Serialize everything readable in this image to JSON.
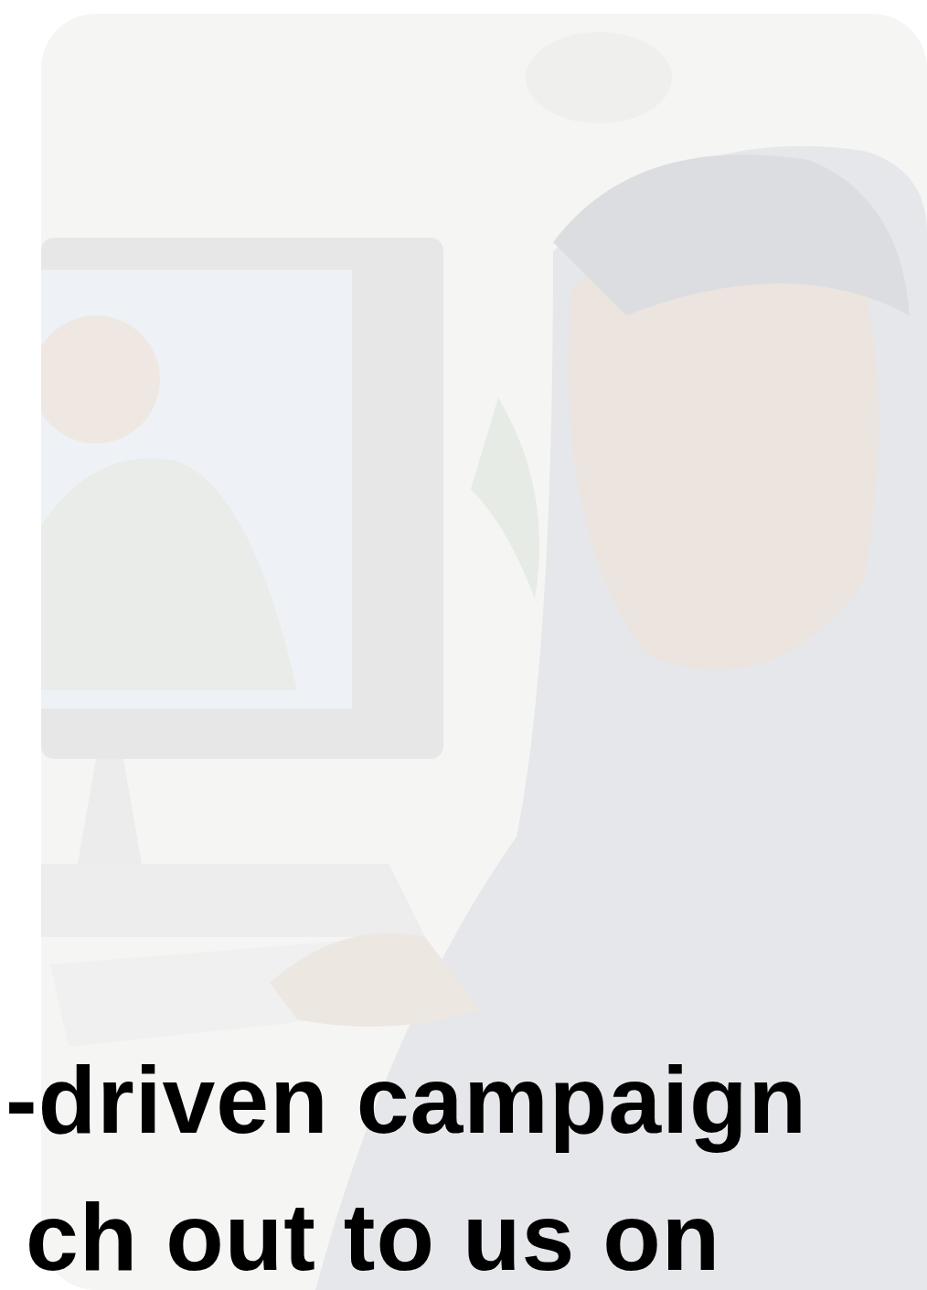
{
  "hero": {
    "lines": [
      "-driven campaign",
      "ch out to us on"
    ]
  }
}
